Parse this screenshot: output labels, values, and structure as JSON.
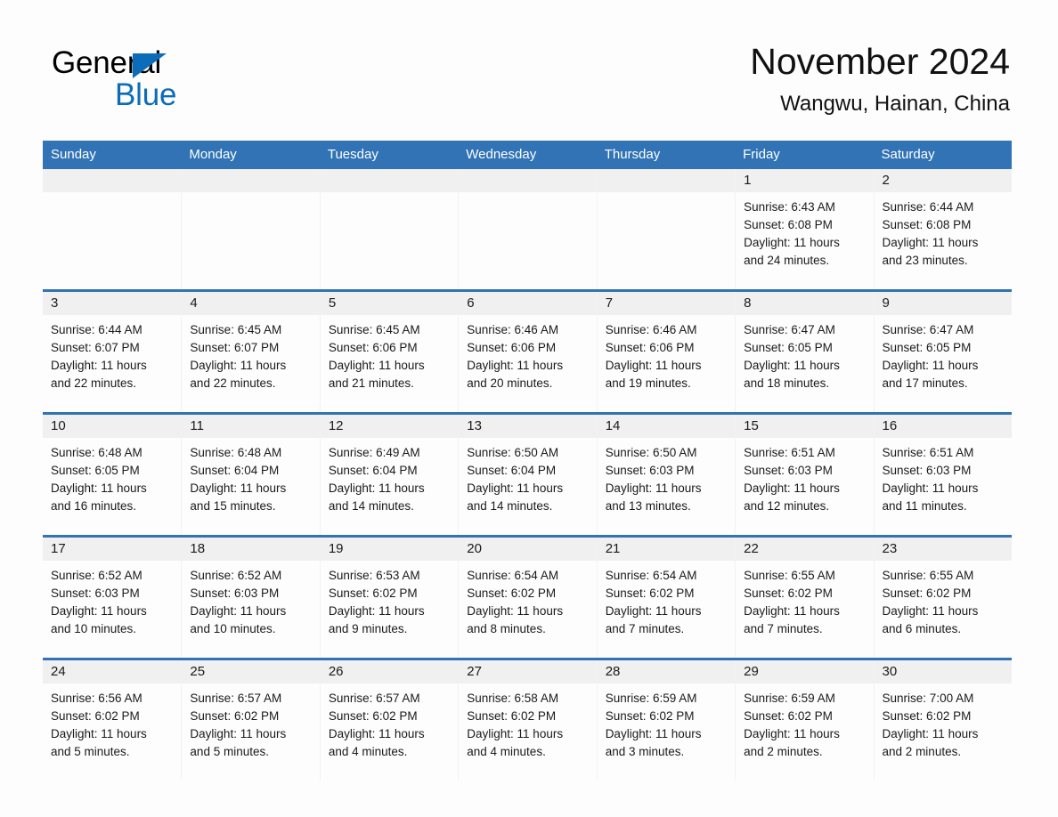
{
  "brand": {
    "line1": "General",
    "line2": "Blue",
    "triangle_color": "#0d6cb9",
    "text_color": "#000000"
  },
  "header": {
    "title": "November 2024",
    "subtitle": "Wangwu, Hainan, China"
  },
  "colors": {
    "header_blue": "#3173b4",
    "daynum_band": "#f0f0f0",
    "page_background": "#fdfdfd",
    "text": "#1a1a1a"
  },
  "weekday_headers": [
    "Sunday",
    "Monday",
    "Tuesday",
    "Wednesday",
    "Thursday",
    "Friday",
    "Saturday"
  ],
  "weeks": [
    [
      {
        "day": "",
        "sunrise": "",
        "sunset": "",
        "daylight1": "",
        "daylight2": ""
      },
      {
        "day": "",
        "sunrise": "",
        "sunset": "",
        "daylight1": "",
        "daylight2": ""
      },
      {
        "day": "",
        "sunrise": "",
        "sunset": "",
        "daylight1": "",
        "daylight2": ""
      },
      {
        "day": "",
        "sunrise": "",
        "sunset": "",
        "daylight1": "",
        "daylight2": ""
      },
      {
        "day": "",
        "sunrise": "",
        "sunset": "",
        "daylight1": "",
        "daylight2": ""
      },
      {
        "day": "1",
        "sunrise": "Sunrise: 6:43 AM",
        "sunset": "Sunset: 6:08 PM",
        "daylight1": "Daylight: 11 hours",
        "daylight2": "and 24 minutes."
      },
      {
        "day": "2",
        "sunrise": "Sunrise: 6:44 AM",
        "sunset": "Sunset: 6:08 PM",
        "daylight1": "Daylight: 11 hours",
        "daylight2": "and 23 minutes."
      }
    ],
    [
      {
        "day": "3",
        "sunrise": "Sunrise: 6:44 AM",
        "sunset": "Sunset: 6:07 PM",
        "daylight1": "Daylight: 11 hours",
        "daylight2": "and 22 minutes."
      },
      {
        "day": "4",
        "sunrise": "Sunrise: 6:45 AM",
        "sunset": "Sunset: 6:07 PM",
        "daylight1": "Daylight: 11 hours",
        "daylight2": "and 22 minutes."
      },
      {
        "day": "5",
        "sunrise": "Sunrise: 6:45 AM",
        "sunset": "Sunset: 6:06 PM",
        "daylight1": "Daylight: 11 hours",
        "daylight2": "and 21 minutes."
      },
      {
        "day": "6",
        "sunrise": "Sunrise: 6:46 AM",
        "sunset": "Sunset: 6:06 PM",
        "daylight1": "Daylight: 11 hours",
        "daylight2": "and 20 minutes."
      },
      {
        "day": "7",
        "sunrise": "Sunrise: 6:46 AM",
        "sunset": "Sunset: 6:06 PM",
        "daylight1": "Daylight: 11 hours",
        "daylight2": "and 19 minutes."
      },
      {
        "day": "8",
        "sunrise": "Sunrise: 6:47 AM",
        "sunset": "Sunset: 6:05 PM",
        "daylight1": "Daylight: 11 hours",
        "daylight2": "and 18 minutes."
      },
      {
        "day": "9",
        "sunrise": "Sunrise: 6:47 AM",
        "sunset": "Sunset: 6:05 PM",
        "daylight1": "Daylight: 11 hours",
        "daylight2": "and 17 minutes."
      }
    ],
    [
      {
        "day": "10",
        "sunrise": "Sunrise: 6:48 AM",
        "sunset": "Sunset: 6:05 PM",
        "daylight1": "Daylight: 11 hours",
        "daylight2": "and 16 minutes."
      },
      {
        "day": "11",
        "sunrise": "Sunrise: 6:48 AM",
        "sunset": "Sunset: 6:04 PM",
        "daylight1": "Daylight: 11 hours",
        "daylight2": "and 15 minutes."
      },
      {
        "day": "12",
        "sunrise": "Sunrise: 6:49 AM",
        "sunset": "Sunset: 6:04 PM",
        "daylight1": "Daylight: 11 hours",
        "daylight2": "and 14 minutes."
      },
      {
        "day": "13",
        "sunrise": "Sunrise: 6:50 AM",
        "sunset": "Sunset: 6:04 PM",
        "daylight1": "Daylight: 11 hours",
        "daylight2": "and 14 minutes."
      },
      {
        "day": "14",
        "sunrise": "Sunrise: 6:50 AM",
        "sunset": "Sunset: 6:03 PM",
        "daylight1": "Daylight: 11 hours",
        "daylight2": "and 13 minutes."
      },
      {
        "day": "15",
        "sunrise": "Sunrise: 6:51 AM",
        "sunset": "Sunset: 6:03 PM",
        "daylight1": "Daylight: 11 hours",
        "daylight2": "and 12 minutes."
      },
      {
        "day": "16",
        "sunrise": "Sunrise: 6:51 AM",
        "sunset": "Sunset: 6:03 PM",
        "daylight1": "Daylight: 11 hours",
        "daylight2": "and 11 minutes."
      }
    ],
    [
      {
        "day": "17",
        "sunrise": "Sunrise: 6:52 AM",
        "sunset": "Sunset: 6:03 PM",
        "daylight1": "Daylight: 11 hours",
        "daylight2": "and 10 minutes."
      },
      {
        "day": "18",
        "sunrise": "Sunrise: 6:52 AM",
        "sunset": "Sunset: 6:03 PM",
        "daylight1": "Daylight: 11 hours",
        "daylight2": "and 10 minutes."
      },
      {
        "day": "19",
        "sunrise": "Sunrise: 6:53 AM",
        "sunset": "Sunset: 6:02 PM",
        "daylight1": "Daylight: 11 hours",
        "daylight2": "and 9 minutes."
      },
      {
        "day": "20",
        "sunrise": "Sunrise: 6:54 AM",
        "sunset": "Sunset: 6:02 PM",
        "daylight1": "Daylight: 11 hours",
        "daylight2": "and 8 minutes."
      },
      {
        "day": "21",
        "sunrise": "Sunrise: 6:54 AM",
        "sunset": "Sunset: 6:02 PM",
        "daylight1": "Daylight: 11 hours",
        "daylight2": "and 7 minutes."
      },
      {
        "day": "22",
        "sunrise": "Sunrise: 6:55 AM",
        "sunset": "Sunset: 6:02 PM",
        "daylight1": "Daylight: 11 hours",
        "daylight2": "and 7 minutes."
      },
      {
        "day": "23",
        "sunrise": "Sunrise: 6:55 AM",
        "sunset": "Sunset: 6:02 PM",
        "daylight1": "Daylight: 11 hours",
        "daylight2": "and 6 minutes."
      }
    ],
    [
      {
        "day": "24",
        "sunrise": "Sunrise: 6:56 AM",
        "sunset": "Sunset: 6:02 PM",
        "daylight1": "Daylight: 11 hours",
        "daylight2": "and 5 minutes."
      },
      {
        "day": "25",
        "sunrise": "Sunrise: 6:57 AM",
        "sunset": "Sunset: 6:02 PM",
        "daylight1": "Daylight: 11 hours",
        "daylight2": "and 5 minutes."
      },
      {
        "day": "26",
        "sunrise": "Sunrise: 6:57 AM",
        "sunset": "Sunset: 6:02 PM",
        "daylight1": "Daylight: 11 hours",
        "daylight2": "and 4 minutes."
      },
      {
        "day": "27",
        "sunrise": "Sunrise: 6:58 AM",
        "sunset": "Sunset: 6:02 PM",
        "daylight1": "Daylight: 11 hours",
        "daylight2": "and 4 minutes."
      },
      {
        "day": "28",
        "sunrise": "Sunrise: 6:59 AM",
        "sunset": "Sunset: 6:02 PM",
        "daylight1": "Daylight: 11 hours",
        "daylight2": "and 3 minutes."
      },
      {
        "day": "29",
        "sunrise": "Sunrise: 6:59 AM",
        "sunset": "Sunset: 6:02 PM",
        "daylight1": "Daylight: 11 hours",
        "daylight2": "and 2 minutes."
      },
      {
        "day": "30",
        "sunrise": "Sunrise: 7:00 AM",
        "sunset": "Sunset: 6:02 PM",
        "daylight1": "Daylight: 11 hours",
        "daylight2": "and 2 minutes."
      }
    ]
  ]
}
